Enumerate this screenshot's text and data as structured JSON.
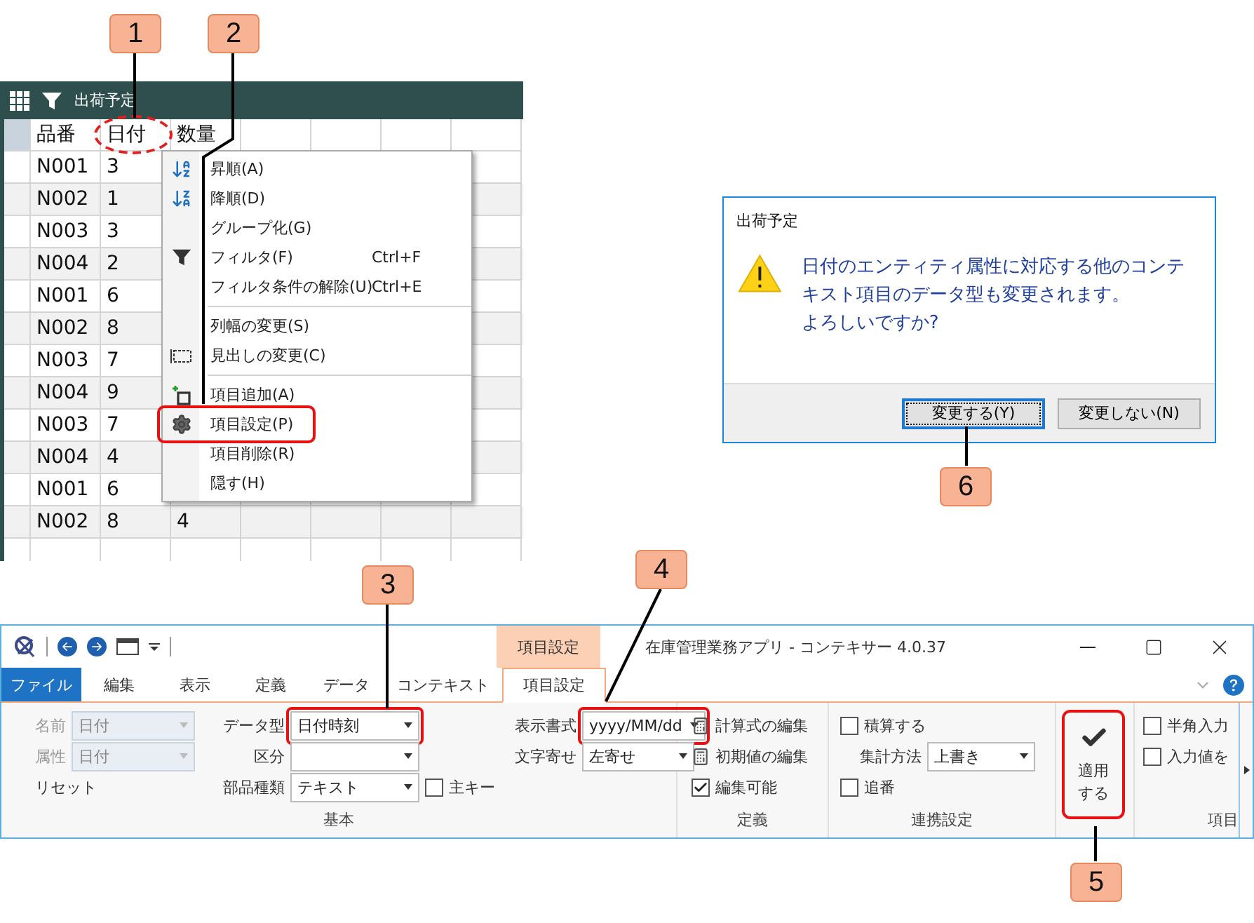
{
  "callouts": [
    {
      "number": "1"
    },
    {
      "number": "2"
    },
    {
      "number": "3"
    },
    {
      "number": "4"
    },
    {
      "number": "5"
    },
    {
      "number": "6"
    }
  ],
  "grid_window": {
    "title": "出荷予定",
    "columns": [
      {
        "label": "品番",
        "circled": false
      },
      {
        "label": "日付",
        "circled": true
      },
      {
        "label": "数量",
        "circled": false
      }
    ],
    "rows": [
      [
        "N001",
        "3"
      ],
      [
        "N002",
        "1"
      ],
      [
        "N003",
        "3"
      ],
      [
        "N004",
        "2"
      ],
      [
        "N001",
        "6"
      ],
      [
        "N002",
        "8"
      ],
      [
        "N003",
        "7"
      ],
      [
        "N004",
        "9"
      ],
      [
        "N003",
        "7"
      ],
      [
        "N004",
        "4"
      ],
      [
        "N001",
        "6"
      ],
      [
        "N002",
        "8",
        "4"
      ]
    ]
  },
  "context_menu": {
    "items": [
      {
        "kind": "command",
        "label": "昇順(A)",
        "highlighted": false
      },
      {
        "kind": "command",
        "label": "降順(D)",
        "highlighted": false
      },
      {
        "kind": "command",
        "label": "グループ化(G)",
        "highlighted": false
      },
      {
        "kind": "command",
        "label": "フィルタ(F)",
        "shortcut": "Ctrl+F",
        "highlighted": false
      },
      {
        "kind": "command",
        "label": "フィルタ条件の解除(U)",
        "shortcut": "Ctrl+E",
        "highlighted": false
      },
      {
        "kind": "separator"
      },
      {
        "kind": "command",
        "label": "列幅の変更(S)",
        "highlighted": false
      },
      {
        "kind": "command",
        "label": "見出しの変更(C)",
        "highlighted": false
      },
      {
        "kind": "separator"
      },
      {
        "kind": "command",
        "label": "項目追加(A)",
        "highlighted": false
      },
      {
        "kind": "command",
        "label": "項目設定(P)",
        "highlighted": true
      },
      {
        "kind": "command",
        "label": "項目削除(R)",
        "highlighted": false
      },
      {
        "kind": "command",
        "label": "隠す(H)",
        "highlighted": false
      }
    ]
  },
  "dialog": {
    "title": "出荷予定",
    "message": [
      "日付のエンティティ属性に対応する他のコンテキスト項目のデータ型も変更されます。",
      "よろしいですか?"
    ],
    "buttons": [
      {
        "label": "変更する(Y)",
        "focused": true
      },
      {
        "label": "変更しない(N)",
        "focused": false
      }
    ]
  },
  "ribbon_window": {
    "title": "在庫管理業務アプリ - コンテキサー 4.0.37",
    "context_tab_group": "項目設定",
    "tabs": [
      {
        "kind": "file",
        "label": "ファイル",
        "selected": false
      },
      {
        "kind": "normal",
        "label": "編集",
        "selected": false
      },
      {
        "kind": "normal",
        "label": "表示",
        "selected": false
      },
      {
        "kind": "normal",
        "label": "定義",
        "selected": false
      },
      {
        "kind": "normal",
        "label": "データ",
        "selected": false
      },
      {
        "kind": "normal",
        "label": "コンテキスト",
        "selected": false
      },
      {
        "kind": "context",
        "label": "項目設定",
        "selected": true
      }
    ],
    "basic_group": {
      "label": "基本",
      "name_field": {
        "label": "名前",
        "value": "日付",
        "disabled": true
      },
      "attribute_field": {
        "label": "属性",
        "value": "日付",
        "disabled": true
      },
      "reset": {
        "label": "リセット"
      },
      "data_type": {
        "label": "データ型",
        "value": "日付時刻",
        "highlighted": true
      },
      "category": {
        "label": "区分"
      },
      "component_type": {
        "label": "部品種類",
        "value": "テキスト"
      },
      "primary_key": {
        "label": "主キー",
        "checked": false
      },
      "display_format": {
        "label": "表示書式",
        "value": "yyyy/MM/dd",
        "highlighted": true
      },
      "alignment": {
        "label": "文字寄せ",
        "value": "左寄せ"
      }
    },
    "definition_group": {
      "label": "定義",
      "items": [
        {
          "kind": "command",
          "label": "計算式の編集"
        },
        {
          "kind": "command",
          "label": "初期値の編集"
        },
        {
          "kind": "checkbox",
          "label": "編集可能",
          "checked": true
        }
      ]
    },
    "link_group": {
      "label": "連携設定",
      "accumulate": {
        "label": "積算する",
        "checked": false
      },
      "aggregate": {
        "label": "集計方法",
        "value": "上書き"
      },
      "sequence": {
        "label": "追番",
        "checked": false
      }
    },
    "apply_button": {
      "label": "適用する",
      "highlighted": true
    },
    "item_group": {
      "label": "項目",
      "options": [
        {
          "label": "半角入力",
          "checked": false
        },
        {
          "label": "入力値を",
          "checked": false
        }
      ]
    }
  }
}
